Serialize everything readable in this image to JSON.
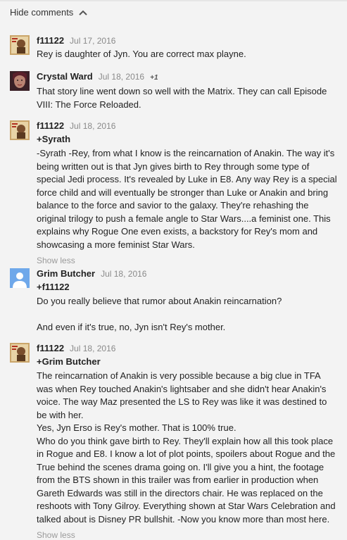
{
  "header": {
    "hide_comments_label": "Hide comments"
  },
  "comments": [
    {
      "author": "f11122",
      "date": "Jul 17, 2016",
      "lines": [
        "Rey is daughter of Jyn. You are correct max playne."
      ]
    },
    {
      "author": "Crystal Ward",
      "date": "Jul 18, 2016",
      "plus": "+1",
      "lines": [
        "That story line went down so well with the Matrix. They can call Episode",
        "VIII: The Force Reloaded."
      ]
    },
    {
      "author": "f11122",
      "date": "Jul 18, 2016",
      "reply_to": "+Syrath",
      "lines": [
        "-Syrath -Rey, from what I know is the reincarnation of Anakin. The way it's",
        "being written out is that Jyn gives birth to Rey through some type of",
        "special Jedi process. It's revealed by Luke in E8. Any way Rey is a special",
        "force child and will eventually be stronger than Luke or Anakin and bring",
        "balance to the force and savior to the galaxy. They're rehashing the",
        "original trilogy to push a female angle to Star Wars....a feminist one. This",
        "explains why Rogue One even exists, a backstory for Rey's mom and",
        "showcasing a more feminist Star Wars."
      ],
      "show_less": "Show less"
    },
    {
      "author": "Grim Butcher",
      "date": "Jul 18, 2016",
      "reply_to": "+f11122",
      "lines": [
        "Do you really believe that rumor about Anakin reincarnation?",
        "",
        "And even if it's true, no, Jyn isn't Rey's mother."
      ]
    },
    {
      "author": "f11122",
      "date": "Jul 18, 2016",
      "reply_to": "+Grim Butcher",
      "lines": [
        "The reincarnation of Anakin is very possible because a big clue in TFA",
        "was when Rey touched Anakin's lightsaber and she didn't hear Anakin's",
        "voice. The way Maz presented the LS to Rey was like it was destined to",
        "be with her.",
        "Yes, Jyn Erso is Rey's mother. That is 100% true.",
        "Who do you think gave birth to Rey. They'll explain how all this took place",
        "in Rogue and E8. I know a lot of plot points, spoilers about Rogue and the",
        "True behind the scenes drama going on. I'll give you a hint, the footage",
        "from the BTS shown in this trailer was from earlier in production when",
        "Gareth Edwards was still in the directors chair. He was replaced on the",
        "reshoots with Tony Gilroy. Everything shown at Star Wars Celebration and",
        "talked about is Disney PR bullshit. -Now you know more than most here."
      ],
      "show_less": "Show less"
    }
  ]
}
